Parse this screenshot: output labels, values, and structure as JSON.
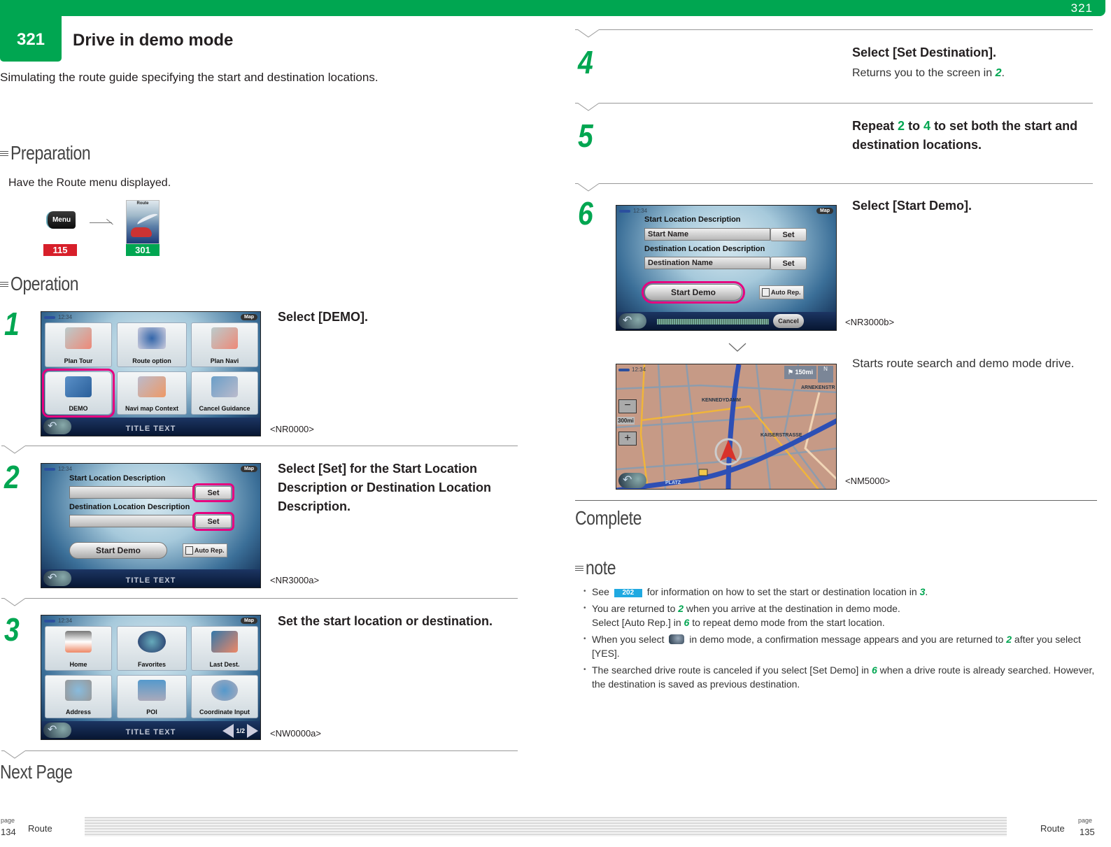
{
  "header": {
    "section_number": "321",
    "top_number": "321",
    "title": "Drive in demo mode",
    "subtitle": "Simulating the route guide specifying the start and destination locations."
  },
  "preparation": {
    "heading": "Preparation",
    "text": "Have the Route menu displayed.",
    "menu_button_label": "Menu",
    "menu_ref": "115",
    "route_icon_label": "Route",
    "route_ref": "301"
  },
  "operation": {
    "heading": "Operation",
    "steps": [
      {
        "number": "1",
        "title": "Select [DEMO].",
        "caption": "<NR0000>",
        "screen": {
          "time": "12:34",
          "map_label": "Map",
          "buttons": [
            "Plan Tour",
            "Route option",
            "Plan Navi",
            "DEMO",
            "Navi map Context",
            "Cancel Guidance"
          ],
          "highlighted": "DEMO",
          "footer_title": "TITLE TEXT"
        }
      },
      {
        "number": "2",
        "title": "Select [Set] for the Start Location Description or Destination Location Description.",
        "caption": "<NR3000a>",
        "screen": {
          "time": "12:34",
          "map_label": "Map",
          "start_label": "Start Location Description",
          "start_value": "",
          "dest_label": "Destination Location Description",
          "dest_value": "",
          "set_label": "Set",
          "start_demo_label": "Start Demo",
          "auto_rep_label": "Auto Rep.",
          "footer_title": "TITLE TEXT"
        }
      },
      {
        "number": "3",
        "title": "Set the start location or destination.",
        "caption": "<NW0000a>",
        "screen": {
          "time": "12:34",
          "map_label": "Map",
          "buttons": [
            "Home",
            "Favorites",
            "Last Dest.",
            "Address",
            "POI",
            "Coordinate Input"
          ],
          "page_indicator": "1/2",
          "footer_title": "TITLE TEXT"
        }
      },
      {
        "number": "4",
        "title": "Select [Set Destination].",
        "desc_prefix": "Returns you to the screen in ",
        "desc_ref": "2",
        "desc_suffix": "."
      },
      {
        "number": "5",
        "title_prefix": "Repeat ",
        "title_ref1": "2",
        "title_mid": " to ",
        "title_ref2": "4",
        "title_suffix": " to set both the start and destination locations."
      },
      {
        "number": "6",
        "title": "Select [Start Demo].",
        "caption": "<NR3000b>",
        "screen": {
          "time": "12:34",
          "map_label": "Map",
          "start_label": "Start Location Description",
          "start_value": "Start Name",
          "dest_label": "Destination Location Description",
          "dest_value": "Destination Name",
          "set_label": "Set",
          "start_demo_label": "Start Demo",
          "auto_rep_label": "Auto Rep.",
          "cancel_label": "Cancel"
        },
        "result_text": "Starts route search and demo mode drive.",
        "result_caption": "<NM5000>",
        "map": {
          "time": "12:34",
          "distance": "150mi",
          "scale": "300mi",
          "streets": [
            "KENNEDYDAMM",
            "KAISERSTRASSE",
            "ARNEKENSTR",
            "PLATZ"
          ],
          "route_marker": "1"
        }
      }
    ]
  },
  "complete_label": "Complete",
  "next_page_label": "Next Page",
  "note": {
    "heading": "note",
    "items": [
      {
        "pre": "See ",
        "ref": "202",
        "mid": " for information on how to set the start or destination location in ",
        "step": "3",
        "post": "."
      },
      {
        "pre": "You are returned to ",
        "step": "2",
        "mid": " when you arrive at the destination in demo mode.",
        "line2_pre": "Select [Auto Rep.] in ",
        "line2_step": "6",
        "line2_post": " to repeat demo mode from the start location."
      },
      {
        "pre": "When you select ",
        "mid": " in demo mode, a confirmation message appears and you are returned to ",
        "step": "2",
        "post": " after you select [YES]."
      },
      {
        "pre": "The searched drive route is canceled if you select [Set Demo] in ",
        "step": "6",
        "post": " when a drive route is already searched. However, the destination is saved as previous destination."
      }
    ]
  },
  "footer": {
    "left_page_label": "page",
    "left_page_number": "134",
    "left_section": "Route",
    "right_page_label": "page",
    "right_page_number": "135",
    "right_section": "Route"
  },
  "colors": {
    "brand_green": "#00a651",
    "ref_red": "#d71f2a",
    "ref_blue": "#1fa9e1",
    "highlight_magenta": "#e6007e"
  }
}
